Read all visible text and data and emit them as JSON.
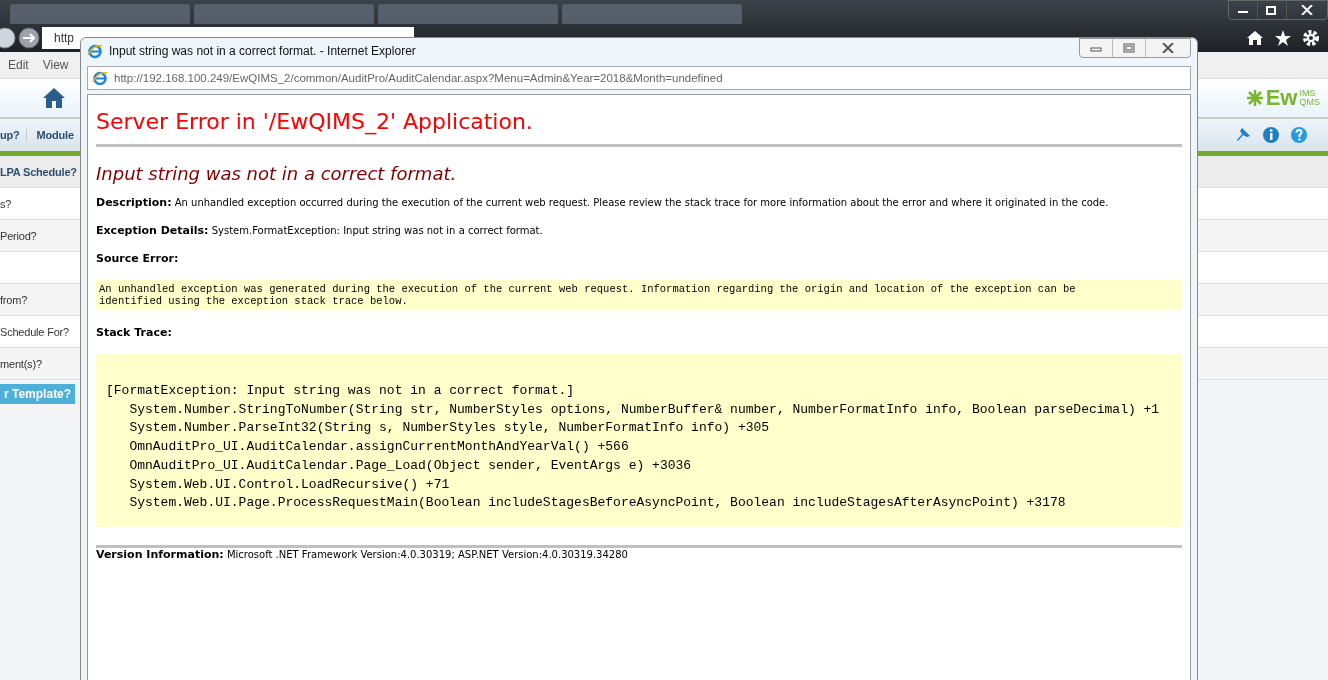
{
  "browser": {
    "address": "http",
    "menu": [
      "Edit",
      "View"
    ]
  },
  "app": {
    "logo": {
      "main": "Ew",
      "top": "IMS",
      "bottom": "QMS"
    },
    "nav": [
      "up?",
      "Module"
    ],
    "rows": [
      {
        "kind": "header",
        "label": "LPA Schedule?"
      },
      {
        "kind": "row",
        "label": "s?"
      },
      {
        "kind": "row",
        "label": "Period?"
      },
      {
        "kind": "row",
        "label": ""
      },
      {
        "kind": "row",
        "label": "from?"
      },
      {
        "kind": "row",
        "label": "Schedule For?"
      },
      {
        "kind": "row",
        "label": "ment(s)?"
      }
    ],
    "button": "r Template?"
  },
  "popup": {
    "title": "Input string was not in a correct format. - Internet Explorer",
    "url": "http://192.168.100.249/EwQIMS_2/common/AuditPro/AuditCalendar.aspx?Menu=Admin&Year=2018&Month=undefined",
    "heading": "Server Error in '/EwQIMS_2' Application.",
    "subheading": "Input string was not in a correct format.",
    "description": "**Description:** An unhandled exception occurred during the execution of the current web request. Please review the stack trace for more information about the error and where it originated in the code.",
    "exception_details": "**Exception Details:** System.FormatException: Input string was not in a correct format.",
    "source_error_label": "Source Error:",
    "source_error": [
      "An unhandled exception was generated during the execution of the current web request. Information regarding the origin and location of the exception can be",
      "identified using the exception stack trace below."
    ],
    "stack_trace_label": "Stack Trace:",
    "stack_trace": [
      "[FormatException: Input string was not in a correct format.]",
      "   System.Number.StringToNumber(String str, NumberStyles options, NumberBuffer& number, NumberFormatInfo info, Boolean parseDecimal) +1",
      "   System.Number.ParseInt32(String s, NumberStyles style, NumberFormatInfo info) +305",
      "   OmnAuditPro_UI.AuditCalendar.assignCurrentMonthAndYearVal() +566",
      "   OmnAuditPro_UI.AuditCalendar.Page_Load(Object sender, EventArgs e) +3036",
      "   System.Web.UI.Control.LoadRecursive() +71",
      "   System.Web.UI.Page.ProcessRequestMain(Boolean includeStagesBeforeAsyncPoint, Boolean includeStagesAfterAsyncPoint) +3178"
    ],
    "version": "**Version Information:** Microsoft .NET Framework Version:4.0.30319; ASP.NET Version:4.0.30319.34280"
  }
}
